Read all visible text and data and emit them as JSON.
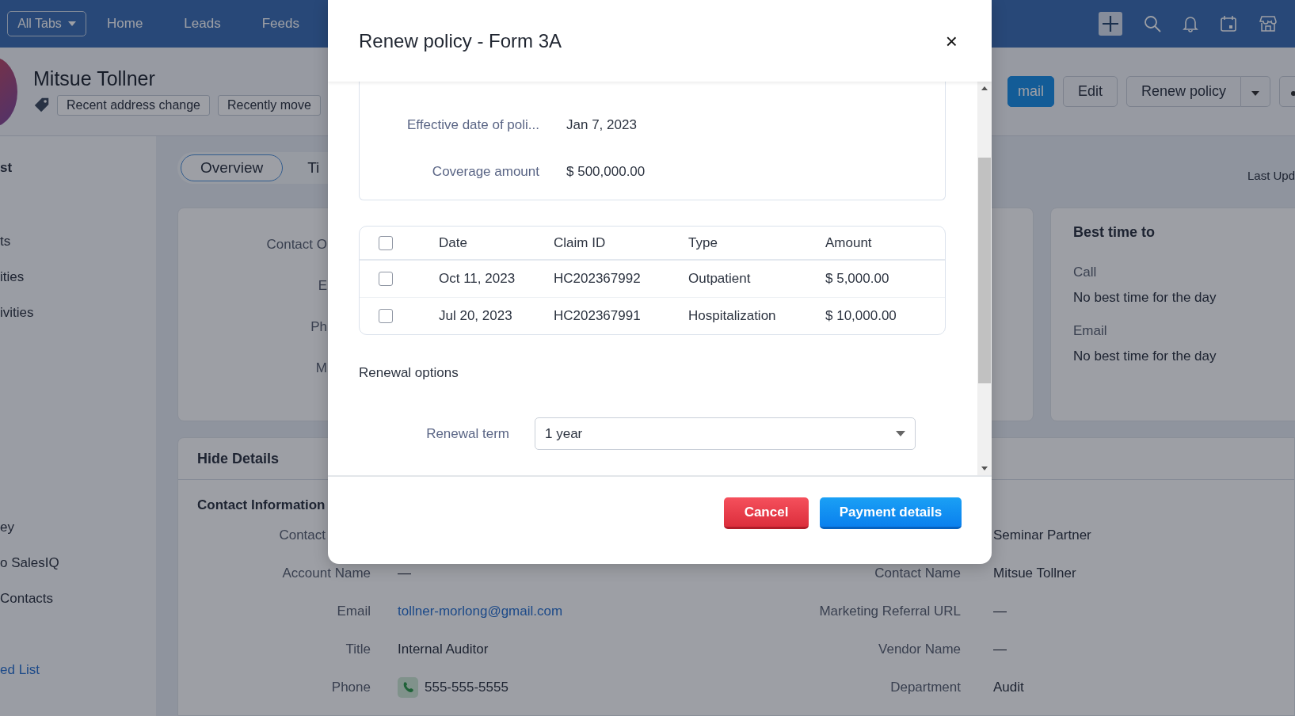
{
  "nav": {
    "all_tabs": "All Tabs",
    "links": [
      "Home",
      "Leads",
      "Feeds"
    ]
  },
  "record": {
    "name": "Mitsue Tollner",
    "tags": [
      "Recent address change",
      "Recently move"
    ],
    "actions": [
      {
        "kind": "primary",
        "label": "mail"
      },
      {
        "kind": "plain",
        "label": "Edit"
      },
      {
        "kind": "split",
        "label": "Renew policy"
      },
      {
        "kind": "more"
      }
    ]
  },
  "sidebar": {
    "items": [
      {
        "kind": "heading",
        "label": "st"
      },
      {
        "kind": "item",
        "label": "ts"
      },
      {
        "kind": "item",
        "label": "ities"
      },
      {
        "kind": "item",
        "label": "ivities"
      },
      {
        "kind": "item",
        "label": "ey"
      },
      {
        "kind": "item",
        "label": "o SalesIQ"
      },
      {
        "kind": "item",
        "label": "Contacts"
      },
      {
        "kind": "link",
        "label": "ed List"
      }
    ]
  },
  "tabs": [
    {
      "label": "Overview",
      "selected": true
    },
    {
      "label": "Ti",
      "selected": false
    }
  ],
  "last_updated": "Last Upd",
  "overview_labels": [
    "Contact O",
    "E",
    "Ph",
    "M"
  ],
  "best_time": {
    "title": "Best time to",
    "items": [
      {
        "label": "Call",
        "value": "No best time for the day"
      },
      {
        "label": "Email",
        "value": "No best time for the day"
      }
    ]
  },
  "details": {
    "toggle": "Hide Details",
    "section": "Contact Information",
    "left": [
      {
        "label": "Contact"
      },
      {
        "label": "Account Name",
        "value": "—"
      },
      {
        "label": "Email",
        "value": "tollner-morlong@gmail.com",
        "kind": "link"
      },
      {
        "label": "Title",
        "value": "Internal Auditor"
      },
      {
        "label": "Phone",
        "value": "555-555-5555",
        "kind": "phone"
      }
    ],
    "right": [
      {
        "value": "Seminar Partner"
      },
      {
        "label": "Contact Name",
        "value": "Mitsue Tollner"
      },
      {
        "label": "Marketing Referral URL",
        "value": "—"
      },
      {
        "label": "Vendor Name",
        "value": "—"
      },
      {
        "label": "Department",
        "value": "Audit"
      }
    ]
  },
  "modal": {
    "title": "Renew policy - Form 3A",
    "close": "×",
    "info": [
      {
        "label": "Effective date of poli...",
        "value": "Jan 7, 2023"
      },
      {
        "label": "Coverage amount",
        "value": "$ 500,000.00"
      }
    ],
    "claims": {
      "header_checked": false,
      "columns": [
        "Date",
        "Claim ID",
        "Type",
        "Amount"
      ],
      "rows": [
        {
          "checked": false,
          "cells": [
            "Oct 11, 2023",
            "HC202367992",
            "Outpatient",
            "$ 5,000.00"
          ]
        },
        {
          "checked": false,
          "cells": [
            "Jul 20, 2023",
            "HC202367991",
            "Hospitalization",
            "$ 10,000.00"
          ]
        }
      ]
    },
    "renewal_heading": "Renewal options",
    "renewal_term": {
      "label": "Renewal term",
      "value": "1 year"
    },
    "buttons": [
      {
        "kind": "cancel",
        "label": "Cancel"
      },
      {
        "kind": "primary",
        "label": "Payment details"
      }
    ]
  }
}
